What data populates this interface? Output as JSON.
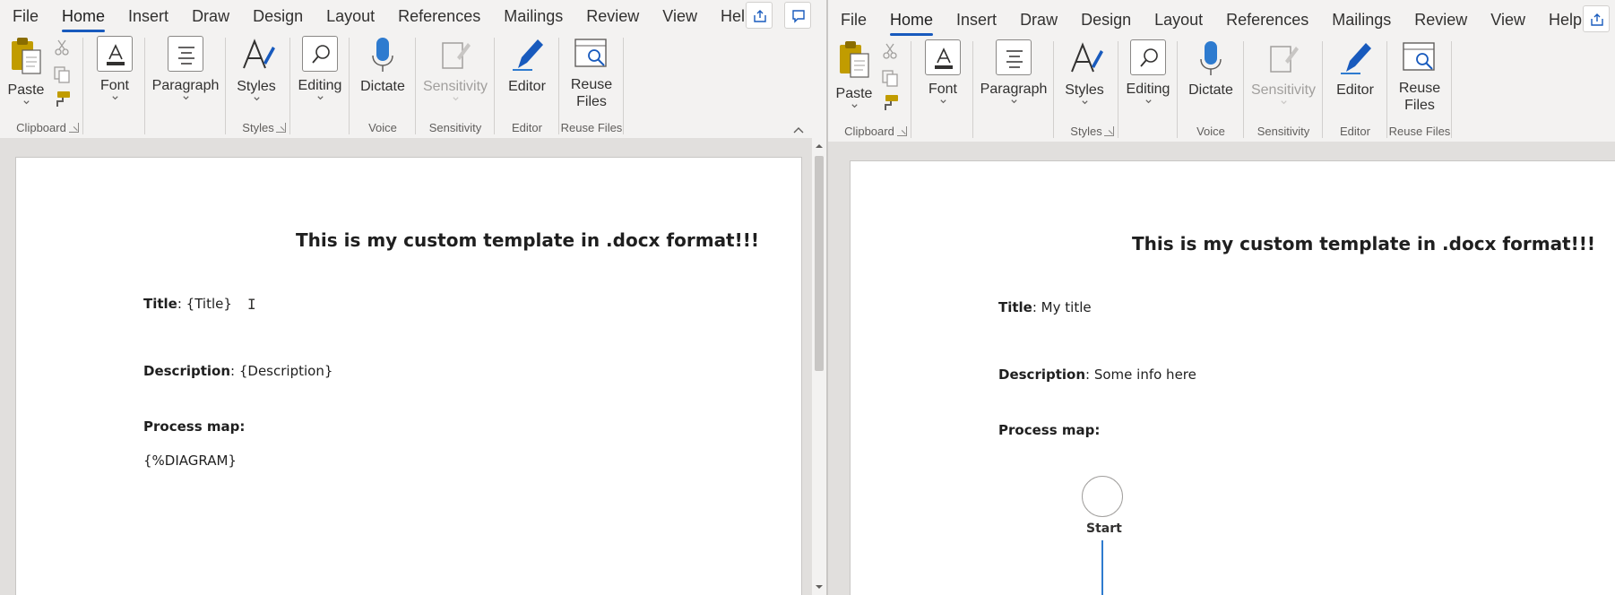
{
  "left_window": {
    "tabs": [
      "File",
      "Home",
      "Insert",
      "Draw",
      "Design",
      "Layout",
      "References",
      "Mailings",
      "Review",
      "View",
      "Help"
    ],
    "active_tab": "Home",
    "ribbon": {
      "paste": "Paste",
      "clipboard_group": "Clipboard",
      "font": "Font",
      "paragraph": "Paragraph",
      "styles": "Styles",
      "styles_group": "Styles",
      "editing": "Editing",
      "dictate": "Dictate",
      "voice_group": "Voice",
      "sensitivity": "Sensitivity",
      "sensitivity_group": "Sensitivity",
      "editor": "Editor",
      "editor_group": "Editor",
      "reuse_files_line1": "Reuse",
      "reuse_files_line2": "Files",
      "reuse_files_group": "Reuse Files"
    },
    "document": {
      "heading": "This is my custom template in .docx format!!!",
      "title_label": "Title",
      "title_value": ": {Title}",
      "description_label": "Description",
      "description_value": ": {Description}",
      "process_map_label": "Process map:",
      "diagram_placeholder": "{%DIAGRAM}"
    }
  },
  "right_window": {
    "tabs": [
      "File",
      "Home",
      "Insert",
      "Draw",
      "Design",
      "Layout",
      "References",
      "Mailings",
      "Review",
      "View",
      "Help"
    ],
    "active_tab": "Home",
    "ribbon": {
      "paste": "Paste",
      "clipboard_group": "Clipboard",
      "font": "Font",
      "paragraph": "Paragraph",
      "styles": "Styles",
      "styles_group": "Styles",
      "editing": "Editing",
      "dictate": "Dictate",
      "voice_group": "Voice",
      "sensitivity": "Sensitivity",
      "sensitivity_group": "Sensitivity",
      "editor": "Editor",
      "editor_group": "Editor",
      "reuse_files_line1": "Reuse",
      "reuse_files_line2": "Files",
      "reuse_files_group": "Reuse Files"
    },
    "document": {
      "heading": "This is my custom template in .docx format!!!",
      "title_label": "Title",
      "title_value": ": My title",
      "description_label": "Description",
      "description_value": ": Some info here",
      "process_map_label": "Process map:",
      "start_node_label": "Start"
    }
  },
  "colors": {
    "ribbon_bg": "#f3f2f1",
    "accent_blue": "#185abd",
    "dictate_blue": "#2e7bcf",
    "paste_gold": "#c19c00",
    "disabled_gray": "#a19f9d"
  }
}
